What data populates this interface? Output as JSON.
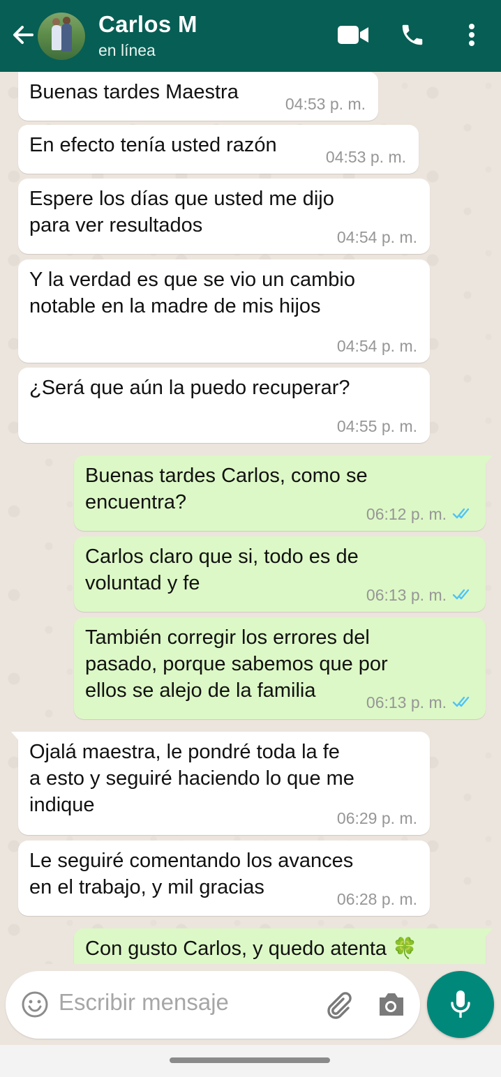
{
  "header": {
    "contact_name": "Carlos M",
    "status": "en línea",
    "color": "#075e54"
  },
  "icons": [
    "back-arrow-icon",
    "avatar",
    "video-call-icon",
    "phone-icon",
    "more-options-icon",
    "emoji-icon",
    "attach-icon",
    "camera-icon",
    "mic-icon"
  ],
  "messages": [
    {
      "dir": "in",
      "text": "Buenas tardes Maestra",
      "time": "04:53 p. m."
    },
    {
      "dir": "in",
      "text": "En efecto tenía usted razón",
      "time": "04:53 p. m."
    },
    {
      "dir": "in",
      "text": "Espere los días que usted me dijo\npara ver resultados",
      "time": "04:54 p. m."
    },
    {
      "dir": "in",
      "text": "Y la verdad es que se vio un cambio\nnotable en la madre de mis hijos",
      "time": "04:54 p. m."
    },
    {
      "dir": "in",
      "text": "¿Será que aún la puedo recuperar?",
      "time": "04:55 p. m."
    },
    {
      "dir": "out",
      "text": "Buenas tardes Carlos, como se\nencuentra?",
      "time": "06:12 p. m.",
      "read": true
    },
    {
      "dir": "out",
      "text": "Carlos claro que si, todo es de\nvoluntad y fe",
      "time": "06:13 p. m.",
      "read": true
    },
    {
      "dir": "out",
      "text": "También corregir los errores del\npasado, porque sabemos que por\nellos se alejo de la familia",
      "time": "06:13 p. m.",
      "read": true
    },
    {
      "dir": "in",
      "text": "Ojalá maestra, le pondré toda la fe\na esto y seguiré haciendo lo que me\nindique",
      "time": "06:29 p. m."
    },
    {
      "dir": "in",
      "text": "Le seguiré comentando los avances\nen el trabajo, y mil gracias",
      "time": "06:28 p. m."
    },
    {
      "dir": "out",
      "text": "Con gusto Carlos, y quedo atenta 🍀",
      "time": ""
    }
  ],
  "composer": {
    "placeholder": "Escribir mensaje"
  },
  "colors": {
    "incoming_bubble": "#ffffff",
    "outgoing_bubble": "#dcf8c6",
    "read_ticks": "#4fc3f7",
    "mic_button": "#00897b"
  }
}
